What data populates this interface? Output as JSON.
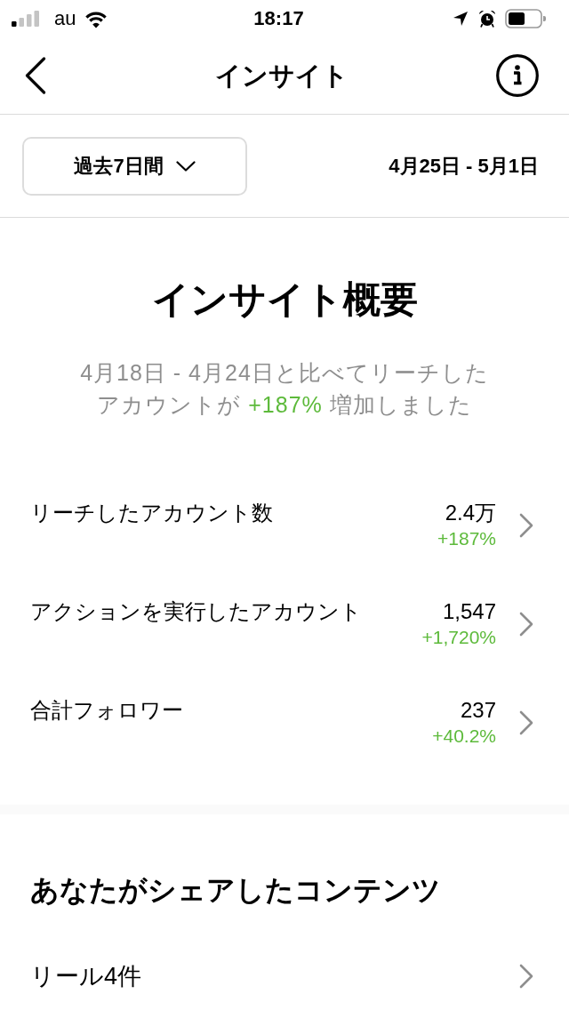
{
  "status_bar": {
    "carrier": "au",
    "time": "18:17"
  },
  "header": {
    "title": "インサイト"
  },
  "date_filter": {
    "period": "過去7日間",
    "range": "4月25日 - 5月1日"
  },
  "overview": {
    "title": "インサイト概要",
    "summary": {
      "before": "4月18日 - 4月24日と比べてリーチしたアカウントが",
      "change": "+187%",
      "after": "増加しました"
    }
  },
  "metrics": [
    {
      "label": "リーチしたアカウント数",
      "value": "2.4万",
      "change": "+187%"
    },
    {
      "label": "アクションを実行したアカウント",
      "value": "1,547",
      "change": "+1,720%"
    },
    {
      "label": "合計フォロワー",
      "value": "237",
      "change": "+40.2%"
    }
  ],
  "shared_content": {
    "title": "あなたがシェアしたコンテンツ",
    "items": [
      {
        "label": "リール4件"
      }
    ]
  }
}
